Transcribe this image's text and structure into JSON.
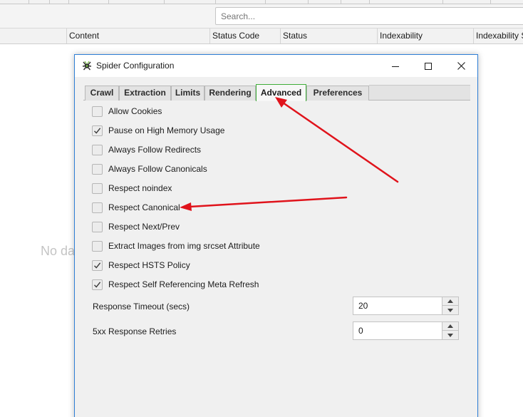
{
  "app": {
    "search_placeholder": "Search...",
    "columns": [
      "Content",
      "Status Code",
      "Status",
      "Indexability",
      "Indexability S"
    ],
    "no_data_text": "No da"
  },
  "dialog": {
    "title": "Spider Configuration",
    "tabs": [
      {
        "label": "Crawl",
        "active": false
      },
      {
        "label": "Extraction",
        "active": false
      },
      {
        "label": "Limits",
        "active": false
      },
      {
        "label": "Rendering",
        "active": false
      },
      {
        "label": "Advanced",
        "active": true
      },
      {
        "label": "Preferences",
        "active": false
      }
    ],
    "options": [
      {
        "label": "Allow Cookies",
        "checked": false
      },
      {
        "label": "Pause on High Memory Usage",
        "checked": true
      },
      {
        "label": "Always Follow Redirects",
        "checked": false
      },
      {
        "label": "Always Follow Canonicals",
        "checked": false
      },
      {
        "label": "Respect noindex",
        "checked": false
      },
      {
        "label": "Respect Canonical",
        "checked": false
      },
      {
        "label": "Respect Next/Prev",
        "checked": false
      },
      {
        "label": "Extract Images from img srcset Attribute",
        "checked": false
      },
      {
        "label": "Respect HSTS Policy",
        "checked": true
      },
      {
        "label": "Respect Self Referencing Meta Refresh",
        "checked": true
      }
    ],
    "response_timeout": {
      "label": "Response Timeout (secs)",
      "value": "20"
    },
    "response_retries": {
      "label": "5xx Response Retries",
      "value": "0"
    }
  },
  "colors": {
    "window_border": "#2f7fd6",
    "active_tab_border": "#3fae39",
    "annotation_arrow": "#e0131b"
  }
}
